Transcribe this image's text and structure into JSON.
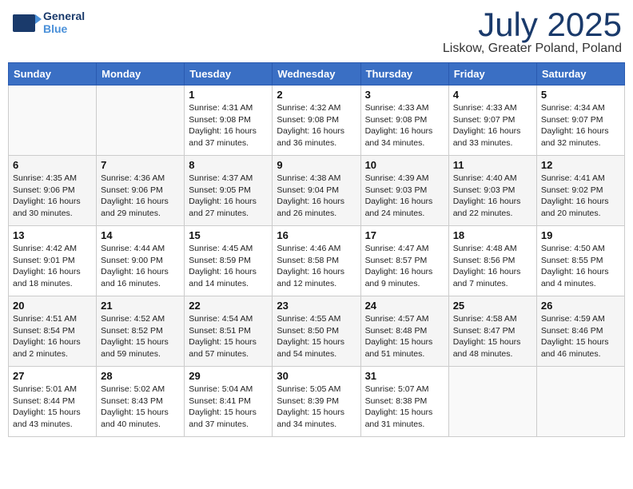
{
  "header": {
    "logo_general": "General",
    "logo_blue": "Blue",
    "month_title": "July 2025",
    "location": "Liskow, Greater Poland, Poland"
  },
  "weekdays": [
    "Sunday",
    "Monday",
    "Tuesday",
    "Wednesday",
    "Thursday",
    "Friday",
    "Saturday"
  ],
  "weeks": [
    [
      {
        "day": "",
        "info": ""
      },
      {
        "day": "",
        "info": ""
      },
      {
        "day": "1",
        "info": "Sunrise: 4:31 AM\nSunset: 9:08 PM\nDaylight: 16 hours\nand 37 minutes."
      },
      {
        "day": "2",
        "info": "Sunrise: 4:32 AM\nSunset: 9:08 PM\nDaylight: 16 hours\nand 36 minutes."
      },
      {
        "day": "3",
        "info": "Sunrise: 4:33 AM\nSunset: 9:08 PM\nDaylight: 16 hours\nand 34 minutes."
      },
      {
        "day": "4",
        "info": "Sunrise: 4:33 AM\nSunset: 9:07 PM\nDaylight: 16 hours\nand 33 minutes."
      },
      {
        "day": "5",
        "info": "Sunrise: 4:34 AM\nSunset: 9:07 PM\nDaylight: 16 hours\nand 32 minutes."
      }
    ],
    [
      {
        "day": "6",
        "info": "Sunrise: 4:35 AM\nSunset: 9:06 PM\nDaylight: 16 hours\nand 30 minutes."
      },
      {
        "day": "7",
        "info": "Sunrise: 4:36 AM\nSunset: 9:06 PM\nDaylight: 16 hours\nand 29 minutes."
      },
      {
        "day": "8",
        "info": "Sunrise: 4:37 AM\nSunset: 9:05 PM\nDaylight: 16 hours\nand 27 minutes."
      },
      {
        "day": "9",
        "info": "Sunrise: 4:38 AM\nSunset: 9:04 PM\nDaylight: 16 hours\nand 26 minutes."
      },
      {
        "day": "10",
        "info": "Sunrise: 4:39 AM\nSunset: 9:03 PM\nDaylight: 16 hours\nand 24 minutes."
      },
      {
        "day": "11",
        "info": "Sunrise: 4:40 AM\nSunset: 9:03 PM\nDaylight: 16 hours\nand 22 minutes."
      },
      {
        "day": "12",
        "info": "Sunrise: 4:41 AM\nSunset: 9:02 PM\nDaylight: 16 hours\nand 20 minutes."
      }
    ],
    [
      {
        "day": "13",
        "info": "Sunrise: 4:42 AM\nSunset: 9:01 PM\nDaylight: 16 hours\nand 18 minutes."
      },
      {
        "day": "14",
        "info": "Sunrise: 4:44 AM\nSunset: 9:00 PM\nDaylight: 16 hours\nand 16 minutes."
      },
      {
        "day": "15",
        "info": "Sunrise: 4:45 AM\nSunset: 8:59 PM\nDaylight: 16 hours\nand 14 minutes."
      },
      {
        "day": "16",
        "info": "Sunrise: 4:46 AM\nSunset: 8:58 PM\nDaylight: 16 hours\nand 12 minutes."
      },
      {
        "day": "17",
        "info": "Sunrise: 4:47 AM\nSunset: 8:57 PM\nDaylight: 16 hours\nand 9 minutes."
      },
      {
        "day": "18",
        "info": "Sunrise: 4:48 AM\nSunset: 8:56 PM\nDaylight: 16 hours\nand 7 minutes."
      },
      {
        "day": "19",
        "info": "Sunrise: 4:50 AM\nSunset: 8:55 PM\nDaylight: 16 hours\nand 4 minutes."
      }
    ],
    [
      {
        "day": "20",
        "info": "Sunrise: 4:51 AM\nSunset: 8:54 PM\nDaylight: 16 hours\nand 2 minutes."
      },
      {
        "day": "21",
        "info": "Sunrise: 4:52 AM\nSunset: 8:52 PM\nDaylight: 15 hours\nand 59 minutes."
      },
      {
        "day": "22",
        "info": "Sunrise: 4:54 AM\nSunset: 8:51 PM\nDaylight: 15 hours\nand 57 minutes."
      },
      {
        "day": "23",
        "info": "Sunrise: 4:55 AM\nSunset: 8:50 PM\nDaylight: 15 hours\nand 54 minutes."
      },
      {
        "day": "24",
        "info": "Sunrise: 4:57 AM\nSunset: 8:48 PM\nDaylight: 15 hours\nand 51 minutes."
      },
      {
        "day": "25",
        "info": "Sunrise: 4:58 AM\nSunset: 8:47 PM\nDaylight: 15 hours\nand 48 minutes."
      },
      {
        "day": "26",
        "info": "Sunrise: 4:59 AM\nSunset: 8:46 PM\nDaylight: 15 hours\nand 46 minutes."
      }
    ],
    [
      {
        "day": "27",
        "info": "Sunrise: 5:01 AM\nSunset: 8:44 PM\nDaylight: 15 hours\nand 43 minutes."
      },
      {
        "day": "28",
        "info": "Sunrise: 5:02 AM\nSunset: 8:43 PM\nDaylight: 15 hours\nand 40 minutes."
      },
      {
        "day": "29",
        "info": "Sunrise: 5:04 AM\nSunset: 8:41 PM\nDaylight: 15 hours\nand 37 minutes."
      },
      {
        "day": "30",
        "info": "Sunrise: 5:05 AM\nSunset: 8:39 PM\nDaylight: 15 hours\nand 34 minutes."
      },
      {
        "day": "31",
        "info": "Sunrise: 5:07 AM\nSunset: 8:38 PM\nDaylight: 15 hours\nand 31 minutes."
      },
      {
        "day": "",
        "info": ""
      },
      {
        "day": "",
        "info": ""
      }
    ]
  ]
}
